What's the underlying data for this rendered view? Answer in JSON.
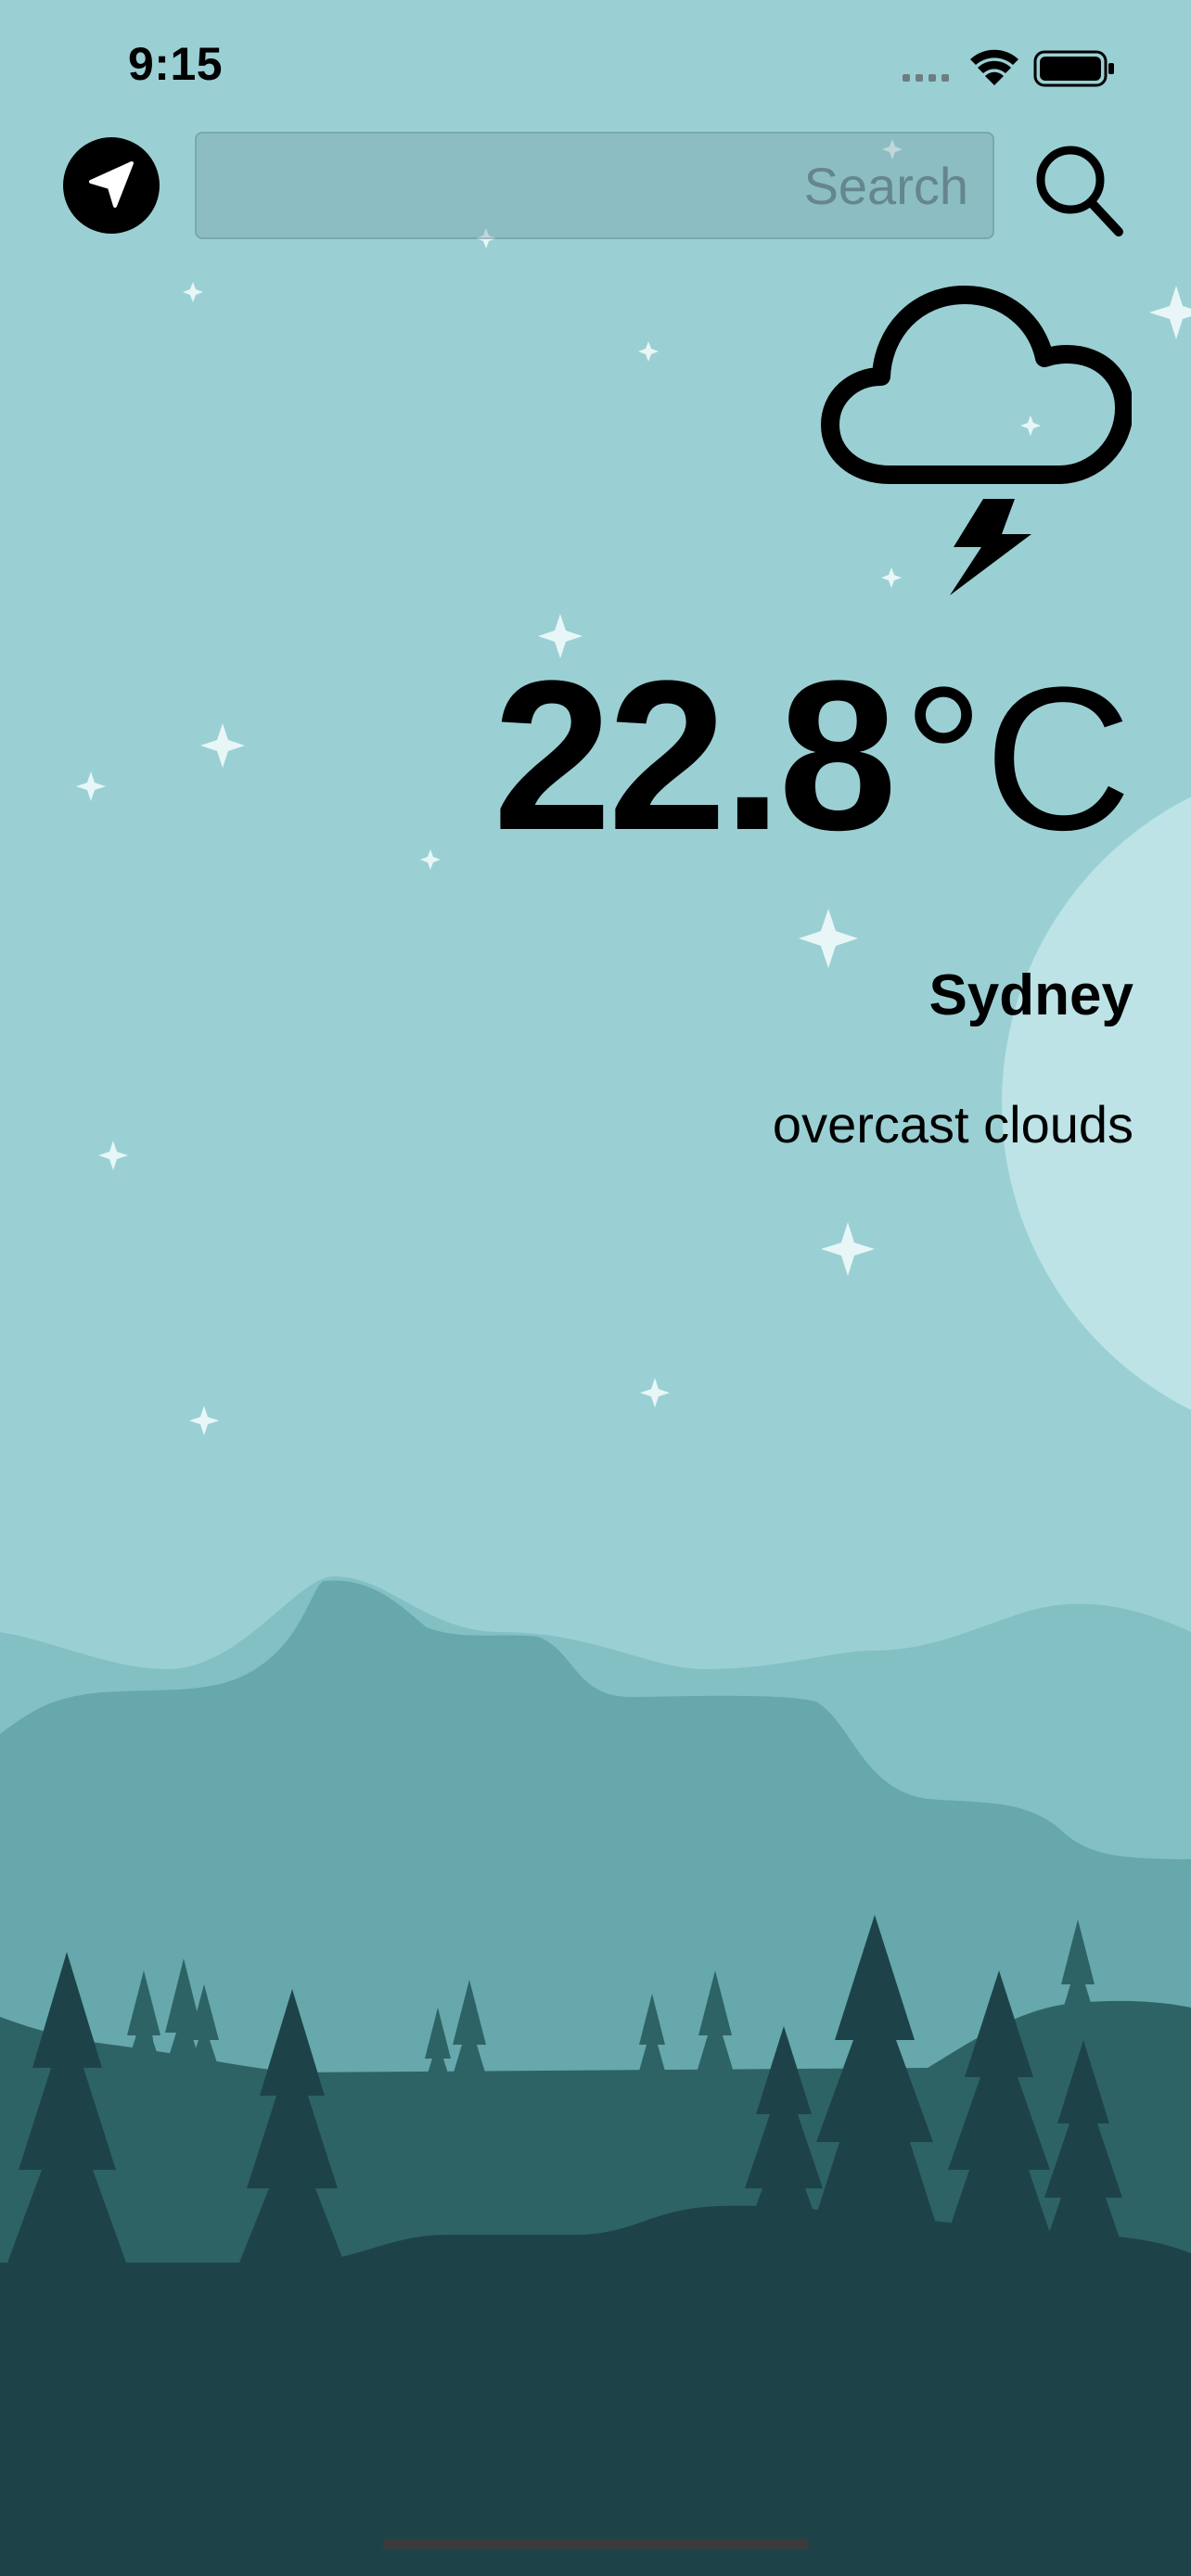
{
  "status_bar": {
    "time": "9:15",
    "icons": [
      "cellular-icon",
      "wifi-icon",
      "battery-icon"
    ]
  },
  "header": {
    "location_button_icon": "location-arrow-icon",
    "search_placeholder": "Search",
    "search_value": "",
    "search_button_icon": "search-icon"
  },
  "weather": {
    "condition_icon": "cloud-lightning-icon",
    "temperature": "22.8",
    "unit": "°C",
    "city": "Sydney",
    "description": "overcast clouds"
  },
  "colors": {
    "sky": "#9ad0d4",
    "moon": "#bde3e6",
    "mountain_far": "#83c0c4",
    "mountain_mid": "#66a8ac",
    "hill": "#2e6366",
    "ground": "#1d4349",
    "accent": "#000000"
  }
}
